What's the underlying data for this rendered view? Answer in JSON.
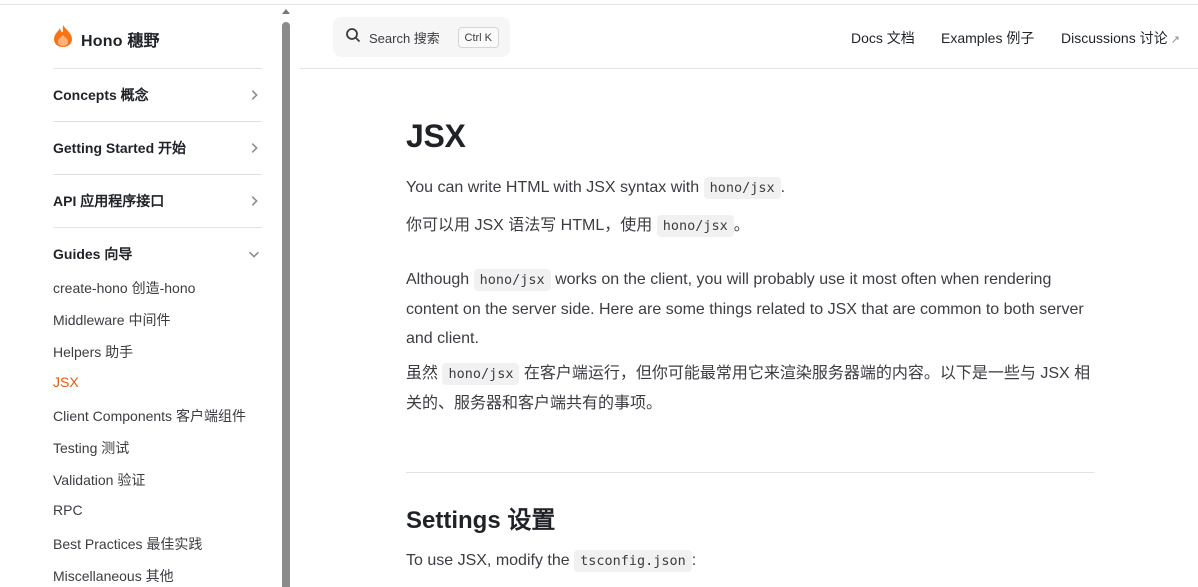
{
  "sidebar": {
    "brand": "Hono  穗野",
    "sections": [
      {
        "label": "Concepts  概念"
      },
      {
        "label": "Getting Started  开始"
      },
      {
        "label": "API  应用程序接口"
      },
      {
        "label": "Guides  向导"
      }
    ],
    "guides": [
      {
        "label": "create-hono  创造-hono"
      },
      {
        "label": "Middleware  中间件"
      },
      {
        "label": "Helpers  助手"
      },
      {
        "label": "JSX"
      },
      {
        "label": "Client Components  客户端组件"
      },
      {
        "label": "Testing  测试"
      },
      {
        "label": "Validation  验证"
      },
      {
        "label": "RPC"
      },
      {
        "label": "Best Practices  最佳实践"
      },
      {
        "label": "Miscellaneous  其他"
      }
    ]
  },
  "nav": {
    "search_label": "Search  搜索",
    "search_shortcut": "Ctrl K",
    "links": [
      {
        "label": "Docs  文档"
      },
      {
        "label": "Examples  例子"
      },
      {
        "label": "Discussions  讨论"
      }
    ]
  },
  "content": {
    "title": "JSX",
    "p1_a": "You can write HTML with JSX syntax with ",
    "p1_code": "hono/jsx",
    "p1_b": ".",
    "p2_a": "你可以用 JSX 语法写 HTML，使用 ",
    "p2_code": "hono/jsx",
    "p2_b": "。",
    "p3_a": "Although ",
    "p3_code": "hono/jsx",
    "p3_b": " works on the client, you will probably use it most often when rendering content on the server side. Here are some things related to JSX that are common to both server and client.",
    "p4_a": "虽然 ",
    "p4_code": "hono/jsx",
    "p4_b": " 在客户端运行，但你可能最常用它来渲染服务器端的内容。以下是一些与 JSX 相关的、服务器和客户端共有的事项。",
    "settings_title": "Settings   设置",
    "p5_a": "To use JSX, modify the ",
    "p5_code": "tsconfig.json",
    "p5_b": ":"
  },
  "colors": {
    "accent": "#e8590c",
    "brand_flame": "#f97316"
  },
  "icons": [
    "hono-flame-logo",
    "chevron-right-icon",
    "chevron-down-icon",
    "search-icon",
    "external-link-icon"
  ]
}
